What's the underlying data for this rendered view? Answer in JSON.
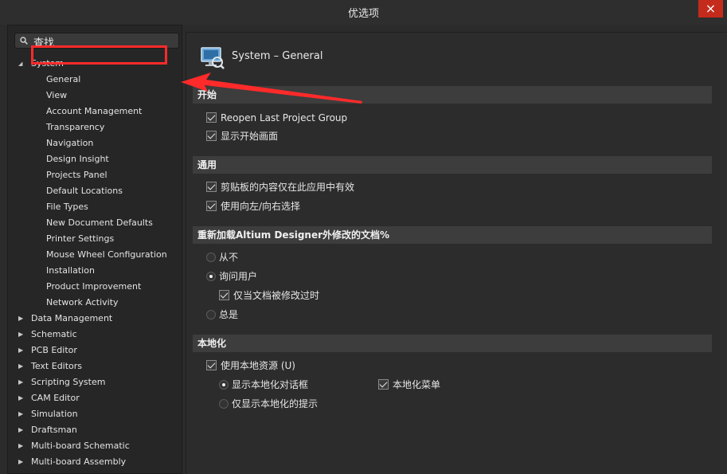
{
  "window": {
    "title": "优选项",
    "close": "×"
  },
  "search": {
    "placeholder": "查找"
  },
  "tree": [
    {
      "label": "System",
      "expanded": true,
      "level": 0
    },
    {
      "label": "General",
      "level": 1,
      "selected": true
    },
    {
      "label": "View",
      "level": 1
    },
    {
      "label": "Account Management",
      "level": 1
    },
    {
      "label": "Transparency",
      "level": 1
    },
    {
      "label": "Navigation",
      "level": 1
    },
    {
      "label": "Design Insight",
      "level": 1
    },
    {
      "label": "Projects Panel",
      "level": 1
    },
    {
      "label": "Default Locations",
      "level": 1
    },
    {
      "label": "File Types",
      "level": 1
    },
    {
      "label": "New Document Defaults",
      "level": 1
    },
    {
      "label": "Printer Settings",
      "level": 1
    },
    {
      "label": "Mouse Wheel Configuration",
      "level": 1
    },
    {
      "label": "Installation",
      "level": 1
    },
    {
      "label": "Product Improvement",
      "level": 1
    },
    {
      "label": "Network Activity",
      "level": 1
    },
    {
      "label": "Data Management",
      "level": 0
    },
    {
      "label": "Schematic",
      "level": 0
    },
    {
      "label": "PCB Editor",
      "level": 0
    },
    {
      "label": "Text Editors",
      "level": 0
    },
    {
      "label": "Scripting System",
      "level": 0
    },
    {
      "label": "CAM Editor",
      "level": 0
    },
    {
      "label": "Simulation",
      "level": 0
    },
    {
      "label": "Draftsman",
      "level": 0
    },
    {
      "label": "Multi-board Schematic",
      "level": 0
    },
    {
      "label": "Multi-board Assembly",
      "level": 0
    }
  ],
  "header": {
    "text": "System – General"
  },
  "sections": {
    "start": {
      "title": "开始",
      "options": [
        {
          "label": "Reopen Last Project Group",
          "checked": true
        },
        {
          "label": "显示开始画面",
          "checked": true
        }
      ]
    },
    "general": {
      "title": "通用",
      "options": [
        {
          "label": "剪贴板的内容仅在此应用中有效",
          "checked": true
        },
        {
          "label": "使用向左/向右选择",
          "checked": true
        }
      ]
    },
    "reload": {
      "title": "重新加载Altium Designer外修改的文档%",
      "options": [
        {
          "label": "从不",
          "selected": false
        },
        {
          "label": "询问用户",
          "selected": true
        },
        {
          "label": "仅当文档被修改过时",
          "checked": true
        },
        {
          "label": "总是",
          "selected": false
        }
      ]
    },
    "localization": {
      "title": "本地化",
      "use_local": {
        "label": "使用本地资源 (U)",
        "checked": true
      },
      "show_dialogs": {
        "label": "显示本地化对话框",
        "selected": true
      },
      "show_hints": {
        "label": "仅显示本地化的提示",
        "selected": false
      },
      "local_menu": {
        "label": "本地化菜单",
        "checked": true
      }
    }
  },
  "colors": {
    "highlight": "#ff2a2a",
    "close": "#c42b1c"
  }
}
